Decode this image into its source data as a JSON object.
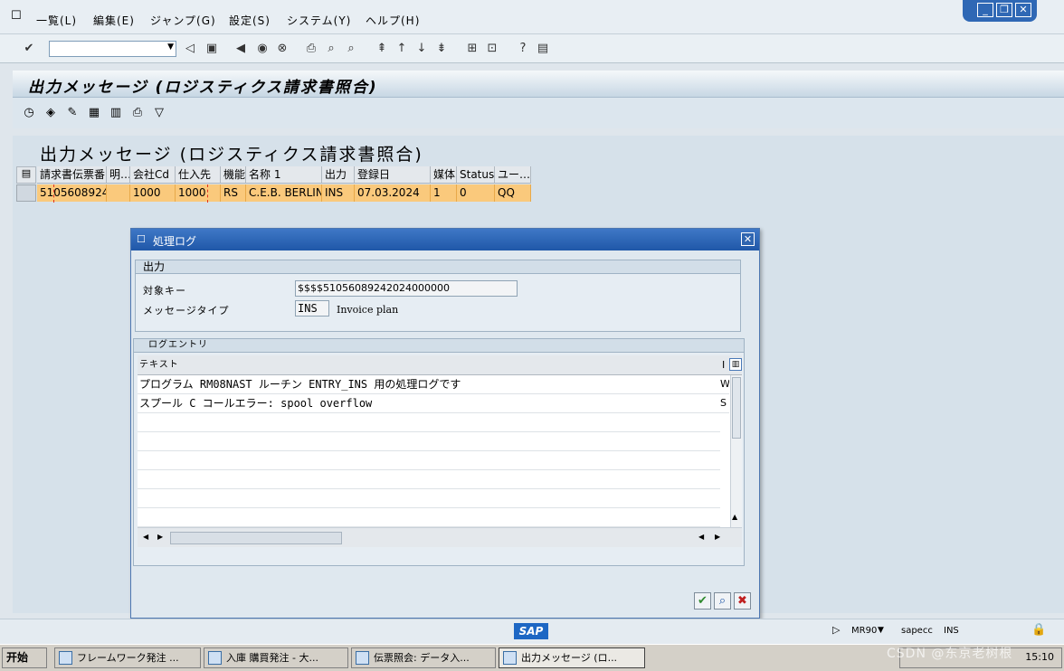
{
  "menubar": {
    "items": [
      "一覧(L)",
      "編集(E)",
      "ジャンプ(G)",
      "設定(S)",
      "システム(Y)",
      "ヘルプ(H)"
    ]
  },
  "window": {
    "title": "出力メッセージ (ロジスティクス請求書照合)"
  },
  "list": {
    "title": "出力メッセージ (ロジスティクス請求書照合)",
    "columns": [
      "請求書伝票番",
      "明…",
      "会社Cd",
      "仕入先",
      "機能",
      "名称 1",
      "出力",
      "登録日",
      "媒体",
      "Status",
      "ユー…"
    ],
    "rows": [
      [
        "5105608924",
        "",
        "1000",
        "1000",
        "RS",
        "C.E.B. BERLIN",
        "INS",
        "07.03.2024",
        "1",
        "0",
        "QQ"
      ]
    ]
  },
  "dialog": {
    "title": "処理ログ",
    "output_group": {
      "title": "出力",
      "object_key_label": "対象キー",
      "object_key_value": "$$$$51056089242024000000",
      "message_type_label": "メッセージタイプ",
      "message_type_value": "INS",
      "message_type_desc": "Invoice plan"
    },
    "log_group": {
      "title": "ログエントリ",
      "header_text": "テキスト",
      "header_col2": "I",
      "rows": [
        {
          "text": "プログラム RM08NAST ルーチン ENTRY_INS 用の処理ログです",
          "col2": "W"
        },
        {
          "text": "スプール C コールエラー: spool overflow",
          "col2": "S"
        }
      ]
    }
  },
  "statusbar": {
    "logo": "SAP",
    "transaction": "MR90",
    "system": "sapecc",
    "mode": "INS"
  },
  "taskbar": {
    "start": "开始",
    "tasks": [
      "フレームワーク発注 ...",
      "入庫 購買発注 - 大...",
      "伝票照会: データ入...",
      "出力メッセージ (ロ..."
    ],
    "clock": "15:10",
    "watermark": "CSDN @东京老树根"
  },
  "colors": {
    "selected_row": "#fac97c",
    "dialog_header": "#2f65b0",
    "sap_logo": "#1d67c4"
  }
}
